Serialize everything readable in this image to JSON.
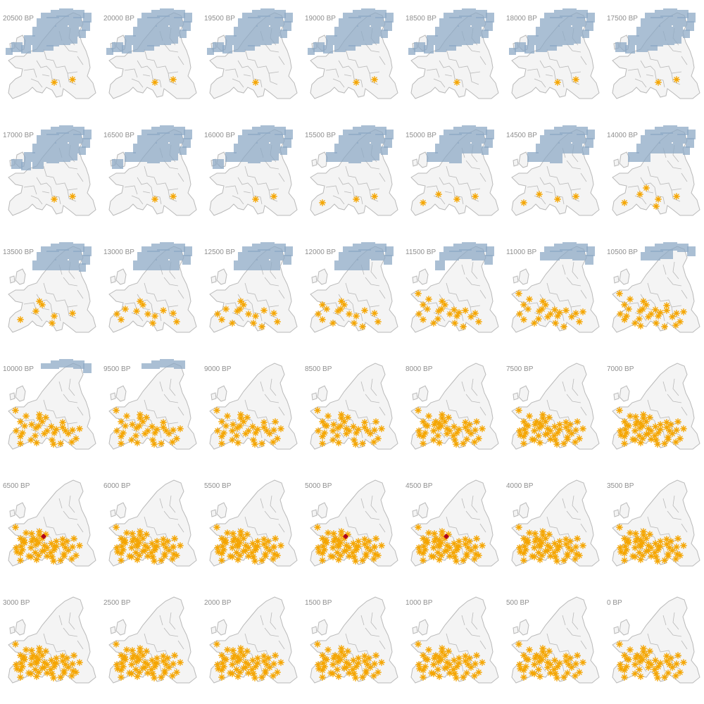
{
  "figure": {
    "colors": {
      "land_fill": "#f4f4f4",
      "border_stroke": "#b9b9b9",
      "ice_fill": "#8eaac6",
      "site_marker": "#f5a500",
      "highlight_marker": "#b0001e",
      "label_text": "#8f8f8f"
    },
    "marker_shape": "asterisk",
    "panels": [
      {
        "label": "20500 BP",
        "ice": 1.0,
        "sites": 2
      },
      {
        "label": "20000 BP",
        "ice": 1.0,
        "sites": 2
      },
      {
        "label": "19500 BP",
        "ice": 1.0,
        "sites": 1
      },
      {
        "label": "19000 BP",
        "ice": 1.0,
        "sites": 2
      },
      {
        "label": "18500 BP",
        "ice": 1.0,
        "sites": 1
      },
      {
        "label": "18000 BP",
        "ice": 1.0,
        "sites": 2
      },
      {
        "label": "17500 BP",
        "ice": 0.95,
        "sites": 2
      },
      {
        "label": "17000 BP",
        "ice": 0.9,
        "sites": 2
      },
      {
        "label": "16500 BP",
        "ice": 0.85,
        "sites": 2
      },
      {
        "label": "16000 BP",
        "ice": 0.82,
        "sites": 2
      },
      {
        "label": "15500 BP",
        "ice": 0.8,
        "sites": 3
      },
      {
        "label": "15000 BP",
        "ice": 0.72,
        "sites": 4
      },
      {
        "label": "14500 BP",
        "ice": 0.7,
        "sites": 4
      },
      {
        "label": "14000 BP",
        "ice": 0.66,
        "sites": 6
      },
      {
        "label": "13500 BP",
        "ice": 0.6,
        "sites": 7
      },
      {
        "label": "13000 BP",
        "ice": 0.58,
        "sites": 12
      },
      {
        "label": "12500 BP",
        "ice": 0.55,
        "sites": 15
      },
      {
        "label": "12000 BP",
        "ice": 0.5,
        "sites": 16
      },
      {
        "label": "11500 BP",
        "ice": 0.45,
        "sites": 22
      },
      {
        "label": "11000 BP",
        "ice": 0.38,
        "sites": 24
      },
      {
        "label": "10500 BP",
        "ice": 0.3,
        "sites": 28
      },
      {
        "label": "10000 BP",
        "ice": 0.18,
        "sites": 34
      },
      {
        "label": "9500 BP",
        "ice": 0.14,
        "sites": 34
      },
      {
        "label": "9000 BP",
        "ice": 0.0,
        "sites": 36
      },
      {
        "label": "8500 BP",
        "ice": 0.0,
        "sites": 38
      },
      {
        "label": "8000 BP",
        "ice": 0.0,
        "sites": 44
      },
      {
        "label": "7500 BP",
        "ice": 0.0,
        "sites": 50
      },
      {
        "label": "7000 BP",
        "ice": 0.0,
        "sites": 52
      },
      {
        "label": "6500 BP",
        "ice": 0.0,
        "sites": 54,
        "highlight": true
      },
      {
        "label": "6000 BP",
        "ice": 0.0,
        "sites": 58
      },
      {
        "label": "5500 BP",
        "ice": 0.0,
        "sites": 60
      },
      {
        "label": "5000 BP",
        "ice": 0.0,
        "sites": 58,
        "highlight": true
      },
      {
        "label": "4500 BP",
        "ice": 0.0,
        "sites": 58,
        "highlight": true
      },
      {
        "label": "4000 BP",
        "ice": 0.0,
        "sites": 56
      },
      {
        "label": "3500 BP",
        "ice": 0.0,
        "sites": 56
      },
      {
        "label": "3000 BP",
        "ice": 0.0,
        "sites": 56
      },
      {
        "label": "2500 BP",
        "ice": 0.0,
        "sites": 54
      },
      {
        "label": "2000 BP",
        "ice": 0.0,
        "sites": 52
      },
      {
        "label": "1500 BP",
        "ice": 0.0,
        "sites": 50
      },
      {
        "label": "1000 BP",
        "ice": 0.0,
        "sites": 48
      },
      {
        "label": "500 BP",
        "ice": 0.0,
        "sites": 46
      },
      {
        "label": "0 BP",
        "ice": 0.0,
        "sites": 44
      }
    ]
  }
}
